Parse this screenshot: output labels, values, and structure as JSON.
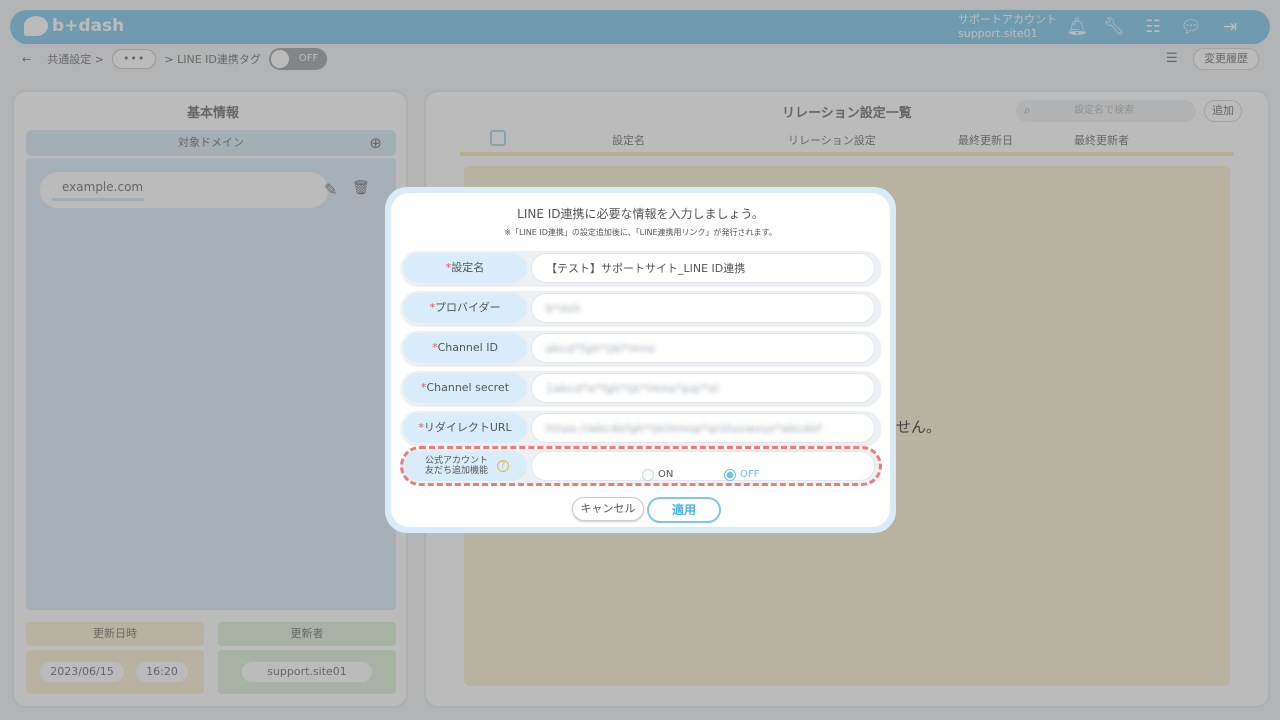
{
  "header": {
    "logo_text": "b+dash",
    "account_line1": "サポートアカウント",
    "account_line2": "support.site01",
    "icons": [
      "bell-icon",
      "wrench-icon",
      "grid-icon",
      "chat-icon",
      "logout-icon"
    ]
  },
  "breadcrumb": {
    "root": "共通設定 >",
    "ellipsis": "•••",
    "current": "> LINE ID連携タグ",
    "toggle_label": "OFF",
    "history_button": "変更履歴"
  },
  "left_panel": {
    "title": "基本情報",
    "domain_header": "対象ドメイン",
    "domain_value": "example.com",
    "updated_at_label": "更新日時",
    "updated_by_label": "更新者",
    "updated_date": "2023/06/15",
    "updated_time": "16:20",
    "updated_by": "support.site01"
  },
  "right_panel": {
    "title": "リレーション設定一覧",
    "search_placeholder": "設定名で検索",
    "add_button": "追加",
    "columns": [
      "設定名",
      "リレーション設定",
      "最終更新日",
      "最終更新者"
    ],
    "empty_tail": "せん。"
  },
  "modal": {
    "title": "LINE ID連携に必要な情報を入力しましょう。",
    "note": "※「LINE ID連携」の設定追加後に、「LINE連携用リンク」が発行されます。",
    "required_mark": "*",
    "fields": [
      {
        "label": "設定名",
        "value": "【テスト】サポートサイト_LINE ID連携"
      },
      {
        "label": "プロバイダー",
        "value": "b*dsh"
      },
      {
        "label": "Channel ID",
        "value": "abcd*fgh*ijkl*mno"
      },
      {
        "label": "Channel secret",
        "value": "1abcd*e*fgh*ijk*lmno*pqr*st"
      },
      {
        "label": "リダイレクトURL",
        "value": "https://abcdefgh*ijklmnop*qrstuvwxyz*abcdef"
      }
    ],
    "toggle_field": {
      "label_line1": "公式アカウント",
      "label_line2": "友だち追加機能",
      "help": "?",
      "option_on": "ON",
      "option_off": "OFF",
      "selected": "OFF"
    },
    "cancel_button": "キャンセル",
    "apply_button": "適用"
  }
}
